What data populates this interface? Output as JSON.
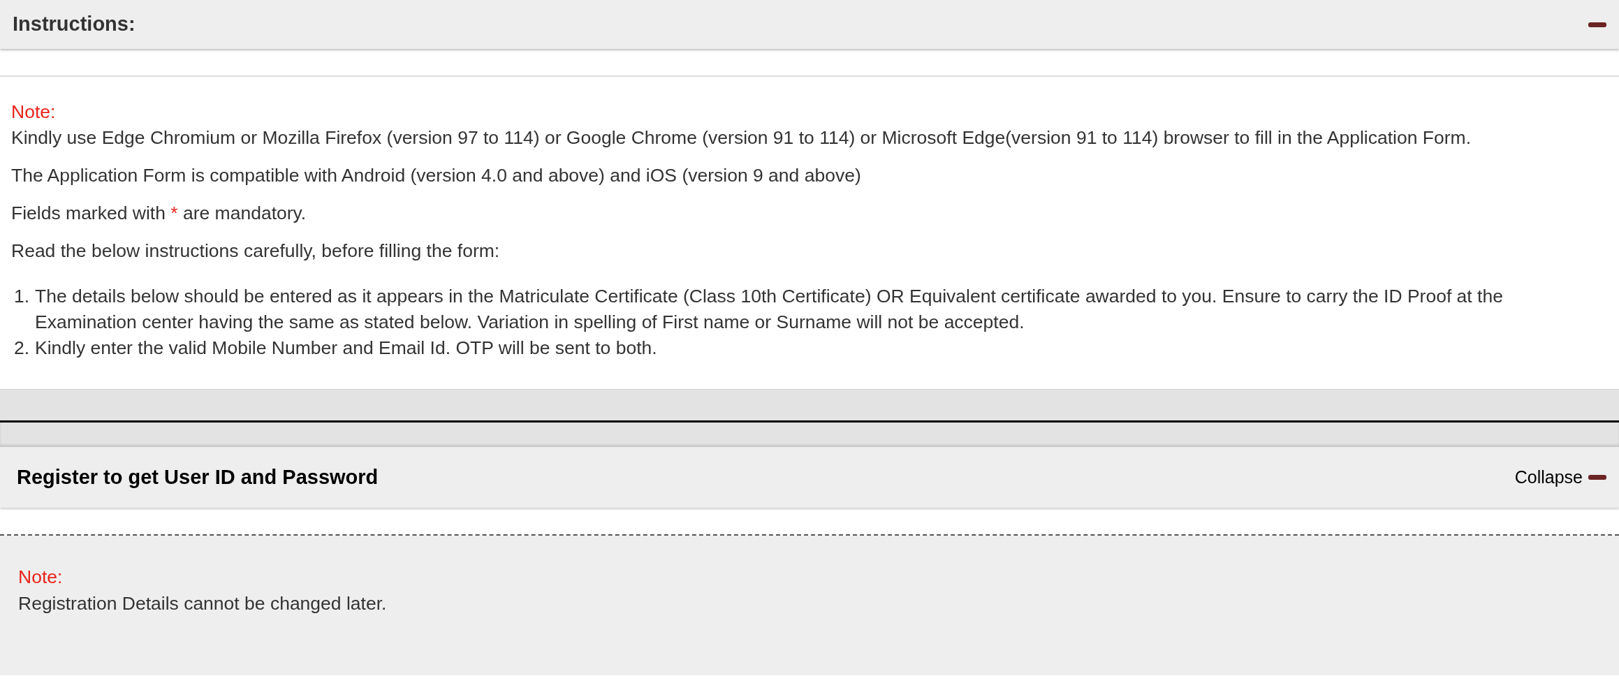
{
  "instructions": {
    "title": "Instructions:",
    "expanded": true,
    "note_label": "Note:",
    "paragraphs": [
      {
        "kind": "plain",
        "text": "Kindly use Edge Chromium or Mozilla Firefox (version 97 to 114) or Google Chrome (version 91 to 114) or Microsoft Edge(version 91 to 114) browser to fill in the Application Form."
      },
      {
        "kind": "plain",
        "text": "The Application Form is compatible with Android (version 4.0 and above) and iOS (version 9 and above)"
      },
      {
        "kind": "required",
        "before": "Fields marked with",
        "mark": "*",
        "after": "are mandatory."
      },
      {
        "kind": "plain",
        "text": "Read the below instructions carefully, before filling the form:"
      }
    ],
    "steps": [
      {
        "marker": "1.",
        "text": "The details below should be entered as it appears in the Matriculate Certificate (Class 10th Certificate) OR Equivalent certificate awarded to you. Ensure to carry the ID Proof at the Examination center having the same as stated below. Variation in spelling of First name or Surname will not be accepted."
      },
      {
        "marker": "2.",
        "text": "Kindly enter the valid Mobile Number and Email Id. OTP will be sent to both."
      }
    ]
  },
  "register": {
    "title": "Register to get User ID and Password",
    "toggle_label": "Collapse",
    "expanded": true,
    "note_label": "Note:",
    "note": "Registration Details cannot be changed later."
  }
}
